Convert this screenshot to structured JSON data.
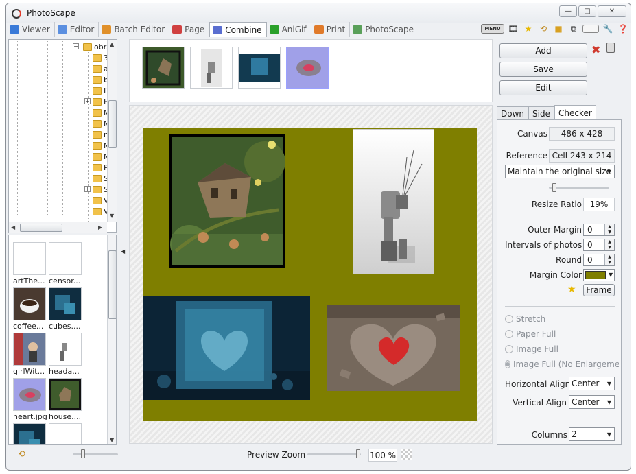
{
  "window": {
    "title": "PhotoScape"
  },
  "tabs": [
    {
      "label": "Viewer",
      "color": "#3a7ad8"
    },
    {
      "label": "Editor",
      "color": "#5b8fe0"
    },
    {
      "label": "Batch Editor",
      "color": "#e0902a"
    },
    {
      "label": "Page",
      "color": "#d04040"
    },
    {
      "label": "Combine",
      "color": "#5a6ed0"
    },
    {
      "label": "AniGif",
      "color": "#2aa02a"
    },
    {
      "label": "Print",
      "color": "#e07a2a"
    },
    {
      "label": "PhotoScape",
      "color": "#5aa05a"
    }
  ],
  "toolbar_icons": {
    "menu_label": "MENU"
  },
  "folder_tree": {
    "root_label": "obra",
    "items": [
      "3",
      "a",
      "b",
      "D",
      "F",
      "M",
      "N",
      "n",
      "N",
      "N",
      "P",
      "S",
      "S",
      "V",
      "V"
    ]
  },
  "file_thumbs": [
    {
      "name": "artThe...",
      "kind": "blank"
    },
    {
      "name": "censor...",
      "kind": "blank"
    },
    {
      "name": "coffee...",
      "kind": "coffee"
    },
    {
      "name": "cubes....",
      "kind": "cubes"
    },
    {
      "name": "girlWit...",
      "kind": "girl"
    },
    {
      "name": "heada...",
      "kind": "robot"
    },
    {
      "name": "heart.jpg",
      "kind": "heart"
    },
    {
      "name": "house....",
      "kind": "house"
    }
  ],
  "strip": [
    "house",
    "robot",
    "cube",
    "heart"
  ],
  "actions": {
    "add": "Add",
    "save": "Save",
    "edit": "Edit"
  },
  "right_tabs": [
    "Down",
    "Side",
    "Checker"
  ],
  "settings": {
    "canvas_label": "Canvas",
    "canvas_value": "486 x 428",
    "reference_label": "Reference",
    "reference_value": "Cell 243 x 214",
    "size_mode": "Maintain the original size",
    "resize_label": "Resize Ratio",
    "resize_value": "19%",
    "outer_margin_label": "Outer Margin",
    "outer_margin_value": "0",
    "intervals_label": "Intervals of photos",
    "intervals_value": "0",
    "round_label": "Round",
    "round_value": "0",
    "margin_color_label": "Margin Color",
    "margin_color": "#7f7f00",
    "frame_label": "Frame",
    "fit_options": [
      "Stretch",
      "Paper Full",
      "Image Full",
      "Image Full (No Enlargement)"
    ],
    "fit_selected": 3,
    "h_align_label": "Horizontal Align",
    "h_align_value": "Center",
    "v_align_label": "Vertical Align",
    "v_align_value": "Center",
    "columns_label": "Columns",
    "columns_value": "2"
  },
  "preview": {
    "zoom_label": "Preview Zoom",
    "zoom_value": "100 %"
  }
}
